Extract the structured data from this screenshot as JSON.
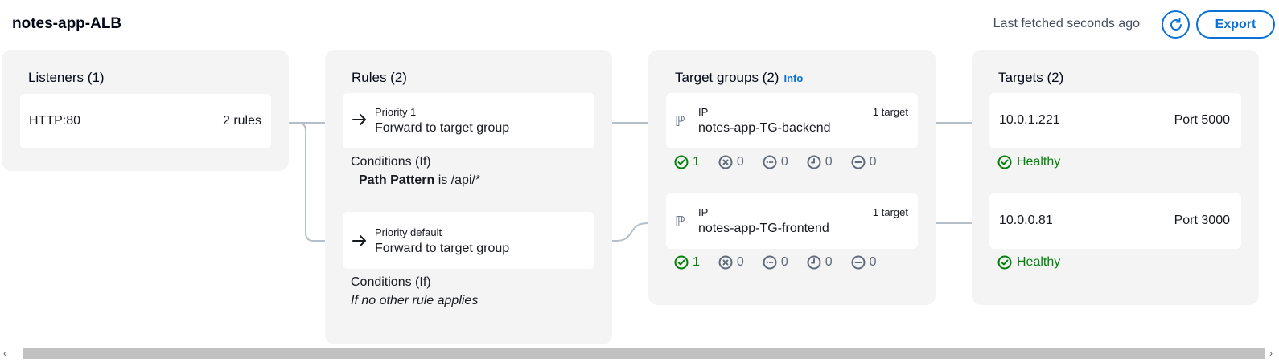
{
  "header": {
    "title": "notes-app-ALB",
    "last_fetched": "Last fetched seconds ago",
    "export_label": "Export"
  },
  "listeners": {
    "title": "Listeners (1)",
    "items": [
      {
        "protocol": "HTTP:80",
        "rules": "2 rules"
      }
    ]
  },
  "rules": {
    "title": "Rules (2)",
    "items": [
      {
        "priority": "Priority 1",
        "action": "Forward to target group",
        "conditions_label": "Conditions (If)",
        "condition_key": "Path Pattern",
        "condition_rest": " is /api/*"
      },
      {
        "priority": "Priority default",
        "action": "Forward to target group",
        "conditions_label": "Conditions (If)",
        "condition_text": "If no other rule applies"
      }
    ]
  },
  "target_groups": {
    "title": "Target groups (2)",
    "info": "Info",
    "items": [
      {
        "type": "IP",
        "name": "notes-app-TG-backend",
        "count": "1 target",
        "healthy": "1",
        "unhealthy": "0",
        "unused": "0",
        "initial": "0",
        "draining": "0"
      },
      {
        "type": "IP",
        "name": "notes-app-TG-frontend",
        "count": "1 target",
        "healthy": "1",
        "unhealthy": "0",
        "unused": "0",
        "initial": "0",
        "draining": "0"
      }
    ]
  },
  "targets": {
    "title": "Targets (2)",
    "items": [
      {
        "ip": "10.0.1.221",
        "port": "Port 5000",
        "status": "Healthy"
      },
      {
        "ip": "10.0.0.81",
        "port": "Port 3000",
        "status": "Healthy"
      }
    ]
  },
  "colors": {
    "accent": "#0972d3",
    "healthy": "#037f0c",
    "panel_bg": "#f4f4f4",
    "connector": "#b6bec9"
  },
  "icons": {
    "refresh": "refresh-icon",
    "arrow": "arrow-right-icon",
    "ip": "ip-address-icon",
    "healthy": "check-circle-icon",
    "unhealthy": "x-circle-icon",
    "unused": "dots-circle-icon",
    "initial": "clock-circle-icon",
    "draining": "minus-circle-icon"
  }
}
